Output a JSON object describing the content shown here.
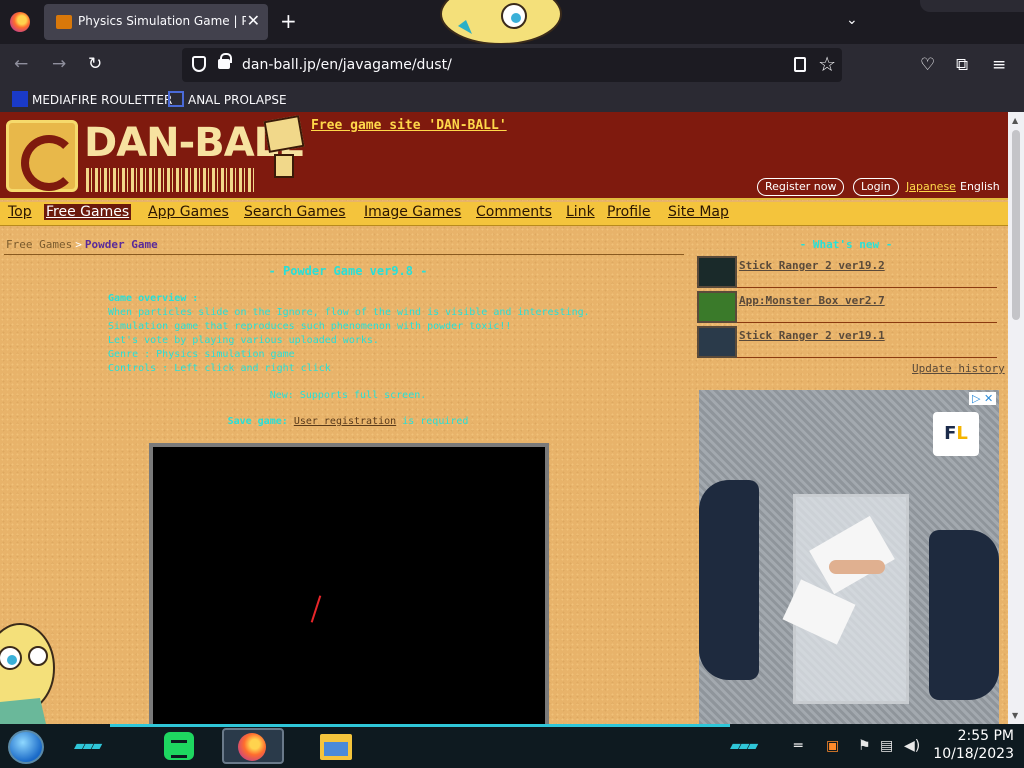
{
  "browser": {
    "tab_title": "Physics Simulation Game | Pow",
    "tab_close": "✕",
    "new_tab": "+",
    "url": "dan-ball.jp/en/javagame/dust/",
    "bookmarks": [
      "MEDIAFIRE ROULETTER",
      "ANAL PROLAPSE"
    ],
    "bookmark_icon_text": "MF\nT"
  },
  "site": {
    "logo": "DAN-BALL",
    "tagline": "Free game site 'DAN-BALL'",
    "register": "Register now",
    "login": "Login",
    "lang_ja": "Japanese",
    "lang_en": "English",
    "menu": [
      "Top",
      "Free Games",
      "App Games",
      "Search Games",
      "Image Games",
      "Comments",
      "Link",
      "Profile",
      "Site Map"
    ],
    "menu_active": "Free Games"
  },
  "crumbs": {
    "home": "Free Games",
    "sep": ">",
    "current": "Powder Game"
  },
  "game": {
    "title": "- Powder Game ver9.8 -",
    "desc": [
      "Game overview :",
      "When particles slide on the Ignore, flow of the wind is visible and interesting.",
      "Simulation game that reproduces such phenomenon with powder toxic!!",
      "Let's vote by playing various uploaded works.",
      "Genre     : Physics simulation game",
      "Controls : Left click and right click"
    ],
    "note1": "New: Supports full screen.",
    "note2_prefix": "Save game:",
    "note2_link": "User registration",
    "note2_suffix": "is required"
  },
  "sidebar": {
    "title": "- What's new -",
    "news": [
      {
        "label": "Stick Ranger 2 ver19.2",
        "thumb_color": "#1a2a2a"
      },
      {
        "label": "App:Monster Box ver2.7",
        "thumb_color": "#3a7a2a"
      },
      {
        "label": "Stick Ranger 2 ver19.1",
        "thumb_color": "#2a3a4a"
      }
    ],
    "update_history": "Update history"
  },
  "ad": {
    "logo_f": "F",
    "logo_l": "L",
    "choice": "▷ ✕"
  },
  "taskbar": {
    "time": "2:55 PM",
    "date": "10/18/2023"
  },
  "colors": {
    "page_bg": "#e8b36a",
    "header_bg": "#7f1a0e",
    "menu_bg": "#f4c43c",
    "cyan_text": "#28e0d8"
  }
}
